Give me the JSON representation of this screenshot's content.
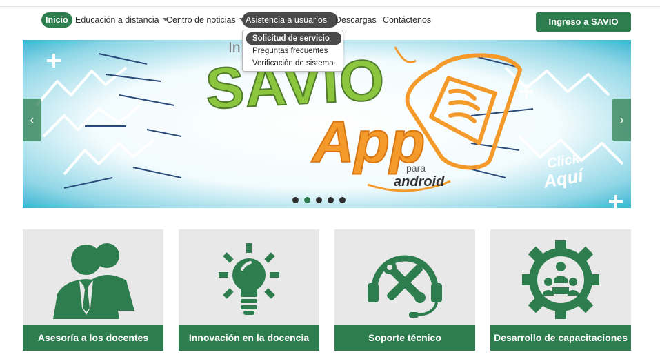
{
  "nav": {
    "items": [
      {
        "label": "Inicio"
      },
      {
        "label": "Educación a distancia"
      },
      {
        "label": "Centro de noticias"
      },
      {
        "label": "Asistencia a usuarios"
      },
      {
        "label": "Descargas"
      },
      {
        "label": "Contáctenos"
      }
    ],
    "login_button": "Ingreso a SAVIO"
  },
  "dropdown": {
    "items": [
      {
        "label": "Solicitud de servicio"
      },
      {
        "label": "Preguntas frecuentes"
      },
      {
        "label": "Verificación de sistema"
      }
    ]
  },
  "carousel": {
    "slide_text": {
      "top": "In        démico",
      "main": "SAVIO",
      "app": "App",
      "para": "para",
      "platform": "android",
      "click": "Click",
      "here": "Aquí"
    },
    "slide_count": 5,
    "active_index": 1,
    "prev_icon": "chevron-left-icon",
    "next_icon": "chevron-right-icon"
  },
  "cards": [
    {
      "label": "Asesoría a los docentes",
      "icon": "teachers-icon"
    },
    {
      "label": "Innovación en la docencia",
      "icon": "lightbulb-icon"
    },
    {
      "label": "Soporte técnico",
      "icon": "tools-support-icon"
    },
    {
      "label": "Desarrollo de capacitaciones",
      "icon": "training-gear-icon"
    }
  ],
  "colors": {
    "brand_green": "#2e7d4f",
    "dark_pill": "#4a4a4a",
    "savio_green": "#8cc63f",
    "app_orange": "#f39a2b",
    "banner_cyan": "#3db8d3"
  }
}
